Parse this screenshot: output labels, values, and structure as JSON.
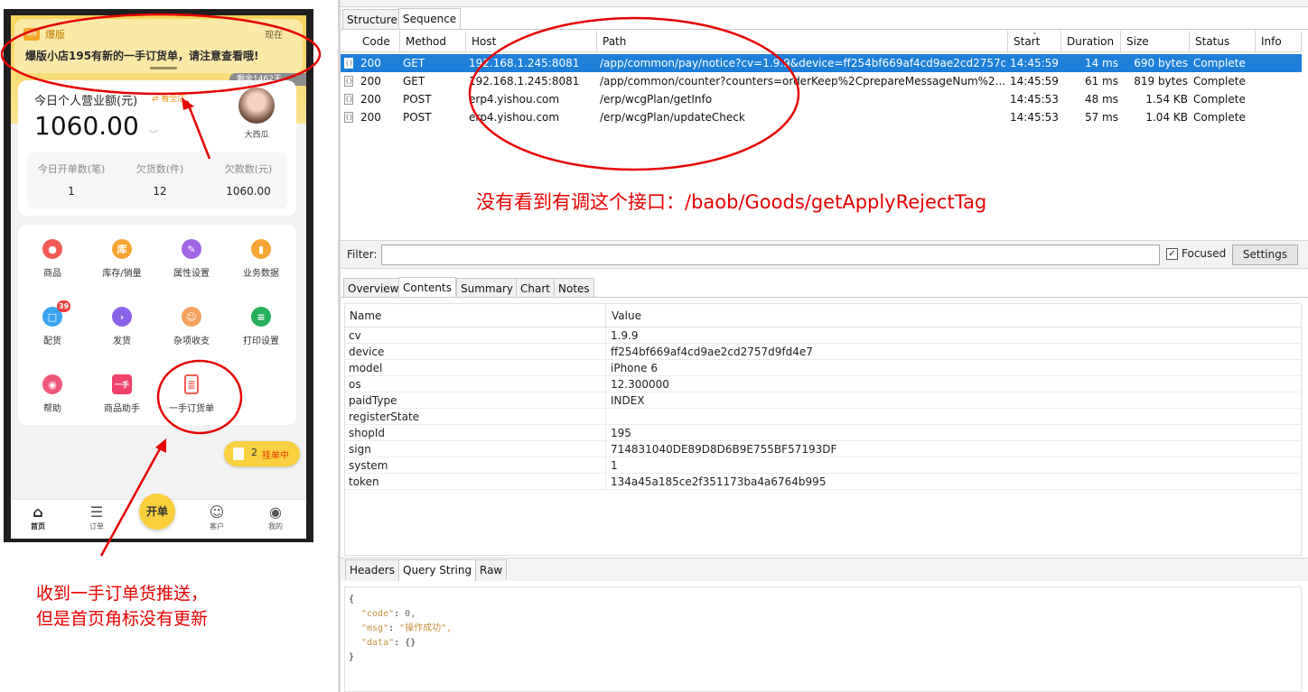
{
  "phone": {
    "notification": {
      "app_name": "爆版",
      "time": "现在",
      "message": "爆版小店195有新的一手订货单，请注意查看哦!",
      "badge": "爆版"
    },
    "remaining": "剩余1462天",
    "revenue_label": "今日个人营业额(元)",
    "view_all": "⇄ 看全店",
    "revenue_value": "1060.00",
    "user_name": "大西瓜",
    "stats": [
      {
        "label": "今日开单数(笔)",
        "value": "1"
      },
      {
        "label": "欠货数(件)",
        "value": "12"
      },
      {
        "label": "欠款数(元)",
        "value": "1060.00"
      }
    ],
    "grid": [
      {
        "label": "商品",
        "icon": "product-icon",
        "color": "#f25c54",
        "glyph": "●"
      },
      {
        "label": "库存/销量",
        "icon": "inventory-icon",
        "color": "#f8a534",
        "glyph": "库"
      },
      {
        "label": "属性设置",
        "icon": "attribute-icon",
        "color": "#a066e6",
        "glyph": "✎"
      },
      {
        "label": "业务数据",
        "icon": "business-data-icon",
        "color": "#f8a534",
        "glyph": "▮"
      },
      {
        "label": "配货",
        "icon": "allocation-icon",
        "color": "#3aa3f0",
        "glyph": "□",
        "badge": "39"
      },
      {
        "label": "发货",
        "icon": "shipping-icon",
        "color": "#8b63e8",
        "glyph": "›"
      },
      {
        "label": "杂项收支",
        "icon": "misc-income-icon",
        "color": "#f6a060",
        "glyph": "☺"
      },
      {
        "label": "打印设置",
        "icon": "print-icon",
        "color": "#25b05a",
        "glyph": "≡"
      },
      {
        "label": "帮助",
        "icon": "help-icon",
        "color": "#f0557a",
        "glyph": "◉"
      },
      {
        "label": "商品助手",
        "icon": "product-assistant-icon",
        "color": "#f0416a",
        "glyph": "一手"
      },
      {
        "label": "一手订货单",
        "icon": "order-sheet-icon",
        "color": "#f25c54",
        "glyph": "≣"
      }
    ],
    "pending_count": "2",
    "pending_label": "挂单中",
    "fab_label": "开单",
    "nav": [
      {
        "label": "首页",
        "icon": "home-icon"
      },
      {
        "label": "订单",
        "icon": "order-list-icon"
      },
      {
        "label": "客户",
        "icon": "customer-icon"
      },
      {
        "label": "我的",
        "icon": "profile-icon"
      }
    ],
    "annotation": [
      "收到一手订单货推送，",
      "但是首页角标没有更新"
    ]
  },
  "inspector": {
    "top_tabs": [
      "Structure",
      "Sequence"
    ],
    "columns": [
      "Code",
      "Method",
      "Host",
      "Path",
      "Start",
      "Duration",
      "Size",
      "Status",
      "Info"
    ],
    "rows": [
      {
        "code": "200",
        "method": "GET",
        "host": "192.168.1.245:8081",
        "path": "/app/common/pay/notice?cv=1.9.9&device=ff254bf669af4cd9ae2cd2757d9...",
        "start": "14:45:59",
        "duration": "14 ms",
        "size": "690 bytes",
        "status": "Complete",
        "selected": true
      },
      {
        "code": "200",
        "method": "GET",
        "host": "192.168.1.245:8081",
        "path": "/app/common/counter?counters=orderKeep%2CprepareMessageNum%2...",
        "start": "14:45:59",
        "duration": "61 ms",
        "size": "819 bytes",
        "status": "Complete",
        "selected": false
      },
      {
        "code": "200",
        "method": "POST",
        "host": "erp4.yishou.com",
        "path": "/erp/wcgPlan/getInfo",
        "start": "14:45:53",
        "duration": "48 ms",
        "size": "1.54 KB",
        "status": "Complete",
        "selected": false
      },
      {
        "code": "200",
        "method": "POST",
        "host": "erp4.yishou.com",
        "path": "/erp/wcgPlan/updateCheck",
        "start": "14:45:53",
        "duration": "57 ms",
        "size": "1.04 KB",
        "status": "Complete",
        "selected": false
      }
    ],
    "annotation": "没有看到有调这个接口：/baob/Goods/getApplyRejectTag",
    "filter_label": "Filter:",
    "filter_value": "",
    "focused_label": "Focused",
    "settings_label": "Settings",
    "detail_tabs": [
      "Overview",
      "Contents",
      "Summary",
      "Chart",
      "Notes"
    ],
    "kv_header": {
      "name": "Name",
      "value": "Value"
    },
    "kv": [
      {
        "name": "cv",
        "value": "1.9.9"
      },
      {
        "name": "device",
        "value": "ff254bf669af4cd9ae2cd2757d9fd4e7"
      },
      {
        "name": "model",
        "value": "iPhone 6"
      },
      {
        "name": "os",
        "value": "12.300000"
      },
      {
        "name": "paidType",
        "value": "INDEX"
      },
      {
        "name": "registerState",
        "value": ""
      },
      {
        "name": "shopId",
        "value": "195"
      },
      {
        "name": "sign",
        "value": "714831040DE89D8D6B9E755BF57193DF"
      },
      {
        "name": "system",
        "value": "1"
      },
      {
        "name": "token",
        "value": "134a45a185ce2f351173ba4a6764b995"
      }
    ],
    "bottom_tabs": [
      "Headers",
      "Query String",
      "Raw"
    ],
    "json": {
      "open": "{",
      "code_key": "\"code\"",
      "code_val": "0,",
      "msg_key": "\"msg\"",
      "msg_val": "\"操作成功\",",
      "data_key": "\"data\"",
      "data_val": "{}",
      "close": "}"
    }
  },
  "colors": {
    "accent": "#f8a534",
    "annotation": "#e60000",
    "selected_row": "#1e7fd8"
  }
}
